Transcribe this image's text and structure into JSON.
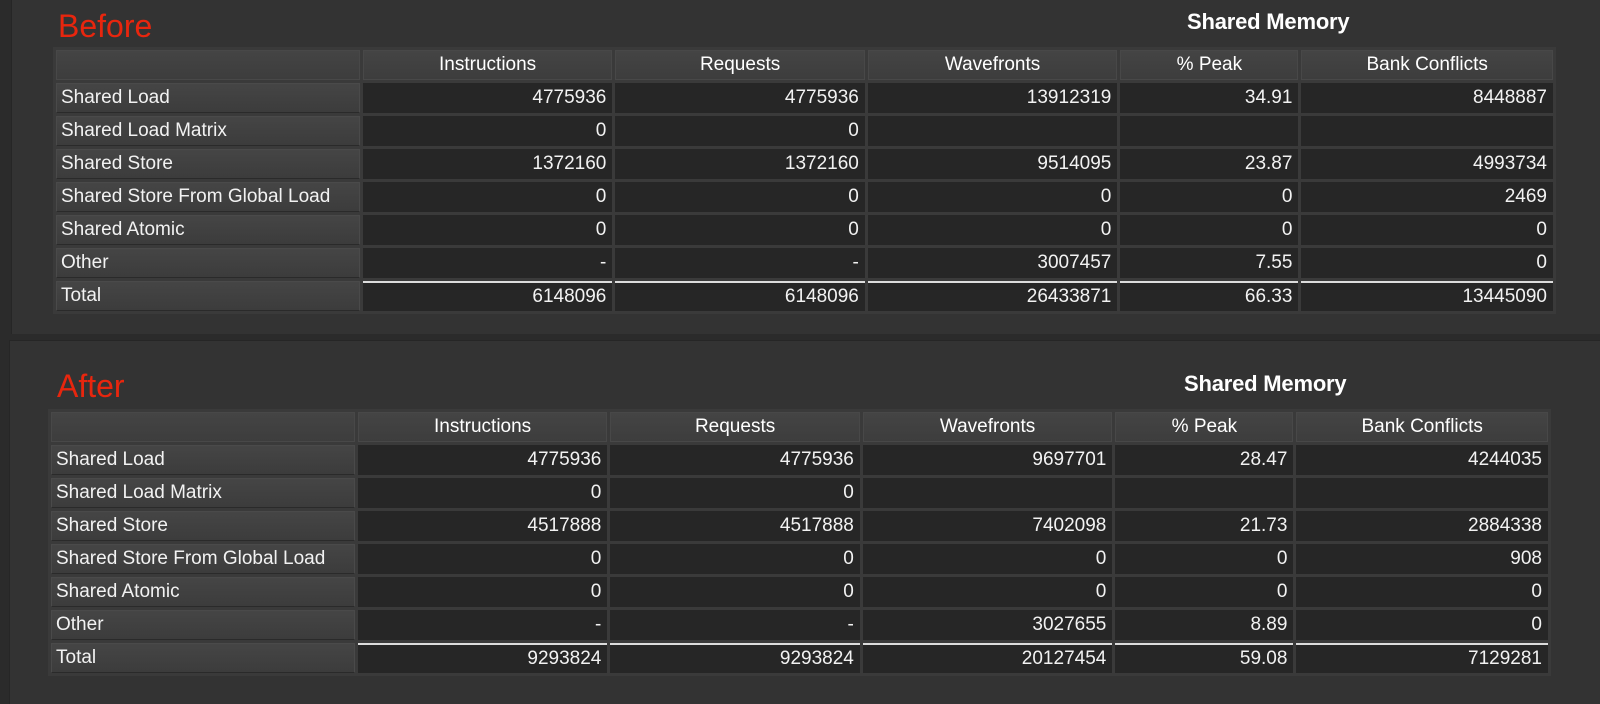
{
  "before": {
    "stage_label": "Before",
    "section_title": "Shared Memory",
    "columns": [
      "",
      "Instructions",
      "Requests",
      "Wavefronts",
      "% Peak",
      "Bank Conflicts"
    ],
    "rows": [
      {
        "label": "Shared Load",
        "values": [
          "4775936",
          "4775936",
          "13912319",
          "34.91",
          "8448887"
        ]
      },
      {
        "label": "Shared Load Matrix",
        "values": [
          "0",
          "0",
          "",
          "",
          ""
        ]
      },
      {
        "label": "Shared Store",
        "values": [
          "1372160",
          "1372160",
          "9514095",
          "23.87",
          "4993734"
        ]
      },
      {
        "label": "Shared Store From Global Load",
        "values": [
          "0",
          "0",
          "0",
          "0",
          "2469"
        ]
      },
      {
        "label": "Shared Atomic",
        "values": [
          "0",
          "0",
          "0",
          "0",
          "0"
        ]
      },
      {
        "label": "Other",
        "values": [
          "-",
          "-",
          "3007457",
          "7.55",
          "0"
        ]
      },
      {
        "label": "Total",
        "values": [
          "6148096",
          "6148096",
          "26433871",
          "66.33",
          "13445090"
        ]
      }
    ]
  },
  "after": {
    "stage_label": "After",
    "section_title": "Shared Memory",
    "columns": [
      "",
      "Instructions",
      "Requests",
      "Wavefronts",
      "% Peak",
      "Bank Conflicts"
    ],
    "rows": [
      {
        "label": "Shared Load",
        "values": [
          "4775936",
          "4775936",
          "9697701",
          "28.47",
          "4244035"
        ]
      },
      {
        "label": "Shared Load Matrix",
        "values": [
          "0",
          "0",
          "",
          "",
          ""
        ]
      },
      {
        "label": "Shared Store",
        "values": [
          "4517888",
          "4517888",
          "7402098",
          "21.73",
          "2884338"
        ]
      },
      {
        "label": "Shared Store From Global Load",
        "values": [
          "0",
          "0",
          "0",
          "0",
          "908"
        ]
      },
      {
        "label": "Shared Atomic",
        "values": [
          "0",
          "0",
          "0",
          "0",
          "0"
        ]
      },
      {
        "label": "Other",
        "values": [
          "-",
          "-",
          "3027655",
          "8.89",
          "0"
        ]
      },
      {
        "label": "Total",
        "values": [
          "9293824",
          "9293824",
          "20127454",
          "59.08",
          "7129281"
        ]
      }
    ]
  },
  "colors": {
    "stage_label": "#e8260e",
    "panel_bg": "#333333",
    "value_cell_bg": "#262626",
    "text": "#f2f2f2"
  }
}
